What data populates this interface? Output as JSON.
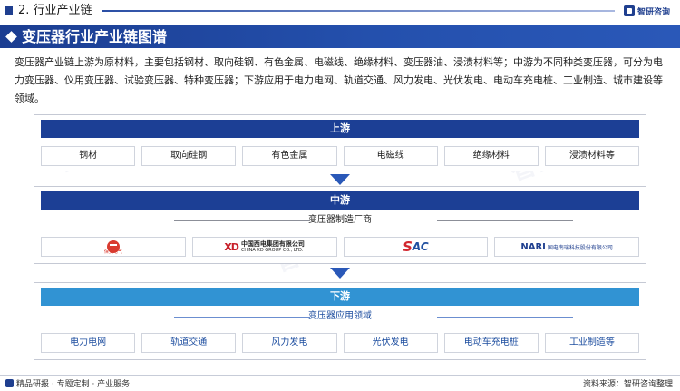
{
  "header": {
    "section_title": "2. 行业产业链",
    "brand": "智研咨询"
  },
  "banner": {
    "title": "变压器行业产业链图谱"
  },
  "intro": "变压器产业链上游为原材料，主要包括钢材、取向硅钢、有色金属、电磁线、绝缘材料、变压器油、浸渍材料等；中游为不同种类变压器，可分为电力变压器、仪用变压器、试验变压器、特种变压器；下游应用于电力电网、轨道交通、风力发电、光伏发电、电动车充电桩、工业制造、城市建设等领域。",
  "upstream": {
    "title": "上游",
    "items": [
      "钢材",
      "取向硅钢",
      "有色金属",
      "电磁线",
      "绝缘材料",
      "浸渍材料等"
    ]
  },
  "midstream": {
    "title": "中游",
    "subtitle": "变压器制造厂商",
    "logos": [
      {
        "name": "logo-1",
        "caption": "保变电气"
      },
      {
        "name": "logo-xd",
        "mark": "XD",
        "cn": "中国西电集团有限公司",
        "en": "CHINA XD GROUP CO., LTD."
      },
      {
        "name": "logo-sac",
        "mark_s": "S",
        "mark_ac": "AC"
      },
      {
        "name": "logo-nari",
        "mark": "NARI",
        "text": "国电南瑞科技股份有限公司"
      }
    ]
  },
  "downstream": {
    "title": "下游",
    "subtitle": "变压器应用领域",
    "items": [
      "电力电网",
      "轨道交通",
      "风力发电",
      "光伏发电",
      "电动车充电桩",
      "工业制造等"
    ]
  },
  "footer": {
    "left": "精品研报 · 专题定制 · 产业服务",
    "right": "资料来源：智研咨询整理"
  },
  "watermark": "智研咨询",
  "colors": {
    "primary": "#1c3f95",
    "secondary": "#3193d3",
    "accent_red": "#d2272f"
  }
}
